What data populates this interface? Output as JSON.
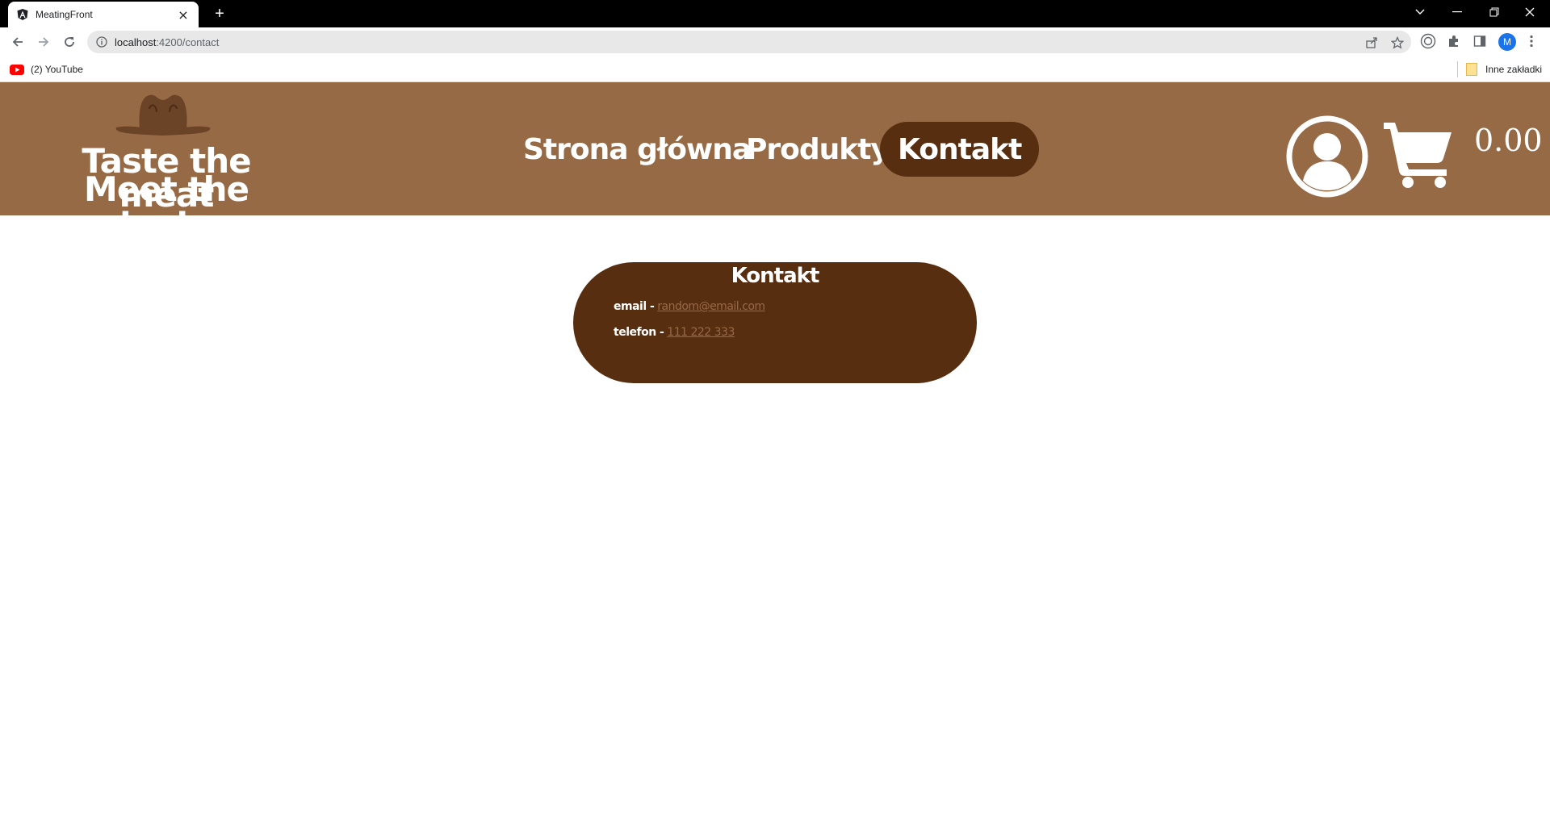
{
  "browser": {
    "tab_title": "MeatingFront",
    "url_host": "localhost",
    "url_rest": ":4200/contact",
    "profile_initial": "M",
    "bookmarks": [
      {
        "label": "(2) YouTube"
      },
      {
        "label": "Inne zakładki"
      }
    ]
  },
  "header": {
    "logo_line1": "Taste the meat",
    "logo_line2": "Meet the taste",
    "nav": [
      {
        "label": "Strona główna",
        "active": false
      },
      {
        "label": "Produkty",
        "active": false
      },
      {
        "label": "Kontakt",
        "active": true
      }
    ],
    "cart_total": "0.00"
  },
  "contact": {
    "title": "Kontakt",
    "email_label": "email -",
    "email_value": "random@email.com",
    "phone_label": "telefon -",
    "phone_value": "111 222 333"
  },
  "colors": {
    "header_bg": "#976a46",
    "accent_dark": "#582e11",
    "link": "#976a46"
  }
}
